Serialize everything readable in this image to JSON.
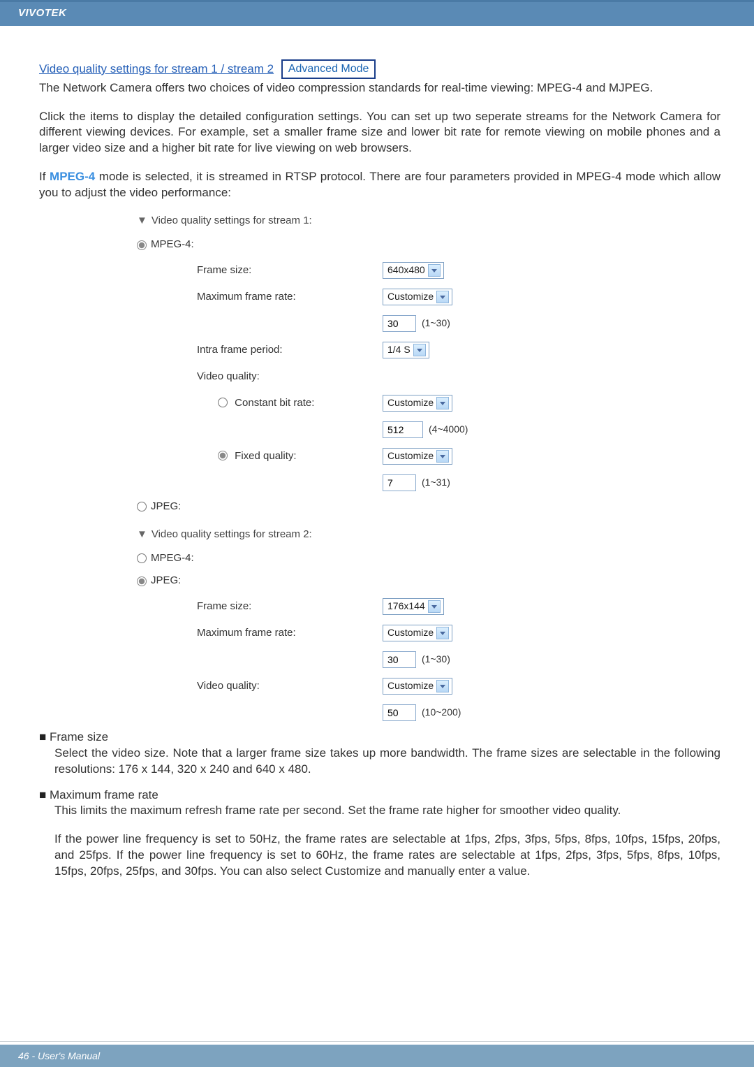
{
  "header": {
    "brand": "VIVOTEK"
  },
  "intro": {
    "link_text": "Video quality settings for stream 1 / stream 2",
    "adv_mode": "Advanced Mode",
    "p1": "The Network Camera offers two choices of video compression standards for real-time viewing: MPEG-4 and MJPEG.",
    "p2": "Click the items to display the detailed configuration settings. You can set up two seperate streams for the Network Camera for different viewing devices. For example, set a smaller frame size and lower bit rate for remote viewing on mobile phones and a larger video size and a higher bit rate for live viewing on web browsers.",
    "p3_a": "If ",
    "p3_mode": "MPEG-4",
    "p3_b": " mode is selected, it is streamed in RTSP protocol. There are four parameters provided in MPEG-4 mode which allow you to adjust the video performance:"
  },
  "settings": {
    "stream1_title": "Video quality settings for stream 1:",
    "stream2_title": "Video quality settings for stream 2:",
    "mpeg4_label": "MPEG-4:",
    "jpeg_label": "JPEG:",
    "frame_size": "Frame size:",
    "max_frame_rate": "Maximum frame rate:",
    "intra_frame": "Intra frame period:",
    "video_quality": "Video quality:",
    "constant_bit": "Constant bit rate:",
    "fixed_quality": "Fixed quality:",
    "s1": {
      "frame_size_val": "640x480",
      "max_rate_sel": "Customize",
      "max_rate_val": "30",
      "max_rate_range": "(1~30)",
      "intra_val": "1/4 S",
      "cbr_sel": "Customize",
      "cbr_val": "512",
      "cbr_range": "(4~4000)",
      "fq_sel": "Customize",
      "fq_val": "7",
      "fq_range": "(1~31)"
    },
    "s2": {
      "frame_size_val": "176x144",
      "max_rate_sel": "Customize",
      "max_rate_val": "30",
      "max_rate_range": "(1~30)",
      "vq_sel": "Customize",
      "vq_val": "50",
      "vq_range": "(10~200)"
    }
  },
  "body2": {
    "frame_size_h": "Frame size",
    "frame_size_t": "Select the video size. Note that a larger frame size takes up more bandwidth. The frame sizes are selectable in the following resolutions: 176 x 144, 320 x 240 and 640 x 480.",
    "max_rate_h": "Maximum frame rate",
    "max_rate_t": "This limits the maximum refresh frame rate per second. Set the frame rate higher for smoother video quality.",
    "max_rate_t2": "If the power line frequency is set to 50Hz, the frame rates are selectable at 1fps, 2fps, 3fps, 5fps, 8fps, 10fps, 15fps, 20fps, and 25fps. If the power line frequency is set to 60Hz, the frame rates are selectable at 1fps, 2fps, 3fps, 5fps, 8fps, 10fps, 15fps, 20fps, 25fps, and 30fps. You can also select Customize and manually enter a value."
  },
  "footer": {
    "text": "46 - User's Manual"
  }
}
